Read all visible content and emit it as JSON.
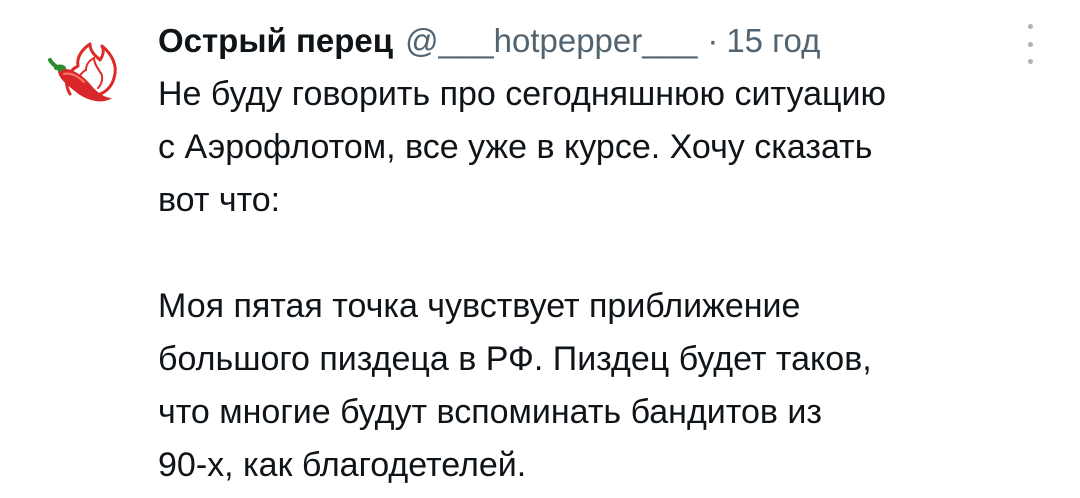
{
  "tweet": {
    "author_name": "Острый перец",
    "handle": "@___hotpepper___",
    "separator": "·",
    "timestamp": "15 год",
    "paragraph1_lines": [
      "Не буду говорить про сегодняшнюю ситуацию",
      "с Аэрофлотом, все уже в курсе. Хочу сказать",
      "вот что:"
    ],
    "paragraph2_lines": [
      "Моя пятая точка чувствует приближение",
      "большого пиздеца в РФ. Пиздец будет таков,",
      "что многие будут вспоминать бандитов из",
      "90-х, как благодетелей."
    ]
  },
  "icons": {
    "avatar": "hot-pepper-icon",
    "more": "more-vertical-icon"
  },
  "colors": {
    "text_primary": "#0f1419",
    "text_secondary": "#536471",
    "pepper_red": "#d8262a",
    "pepper_green": "#2f8a2f"
  }
}
